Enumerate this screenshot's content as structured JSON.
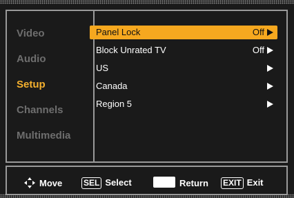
{
  "sidebar": {
    "items": [
      {
        "label": "Video"
      },
      {
        "label": "Audio"
      },
      {
        "label": "Setup"
      },
      {
        "label": "Channels"
      },
      {
        "label": "Multimedia"
      }
    ],
    "active": "Setup"
  },
  "menu": {
    "items": [
      {
        "label": "Panel Lock",
        "value": "Off"
      },
      {
        "label": "Block Unrated TV",
        "value": "Off"
      },
      {
        "label": "US",
        "value": ""
      },
      {
        "label": "Canada",
        "value": ""
      },
      {
        "label": "Region 5",
        "value": ""
      }
    ],
    "selected": "Panel Lock"
  },
  "footer": {
    "move_label": "Move",
    "select_key": "SEL",
    "select_label": "Select",
    "return_label": "Return",
    "exit_key": "EXIT",
    "exit_label": "Exit"
  },
  "colors": {
    "accent": "#f6a81f",
    "active_text": "#f4b02e",
    "inactive_text": "#6e6e6e",
    "background": "#1a1a1a"
  }
}
